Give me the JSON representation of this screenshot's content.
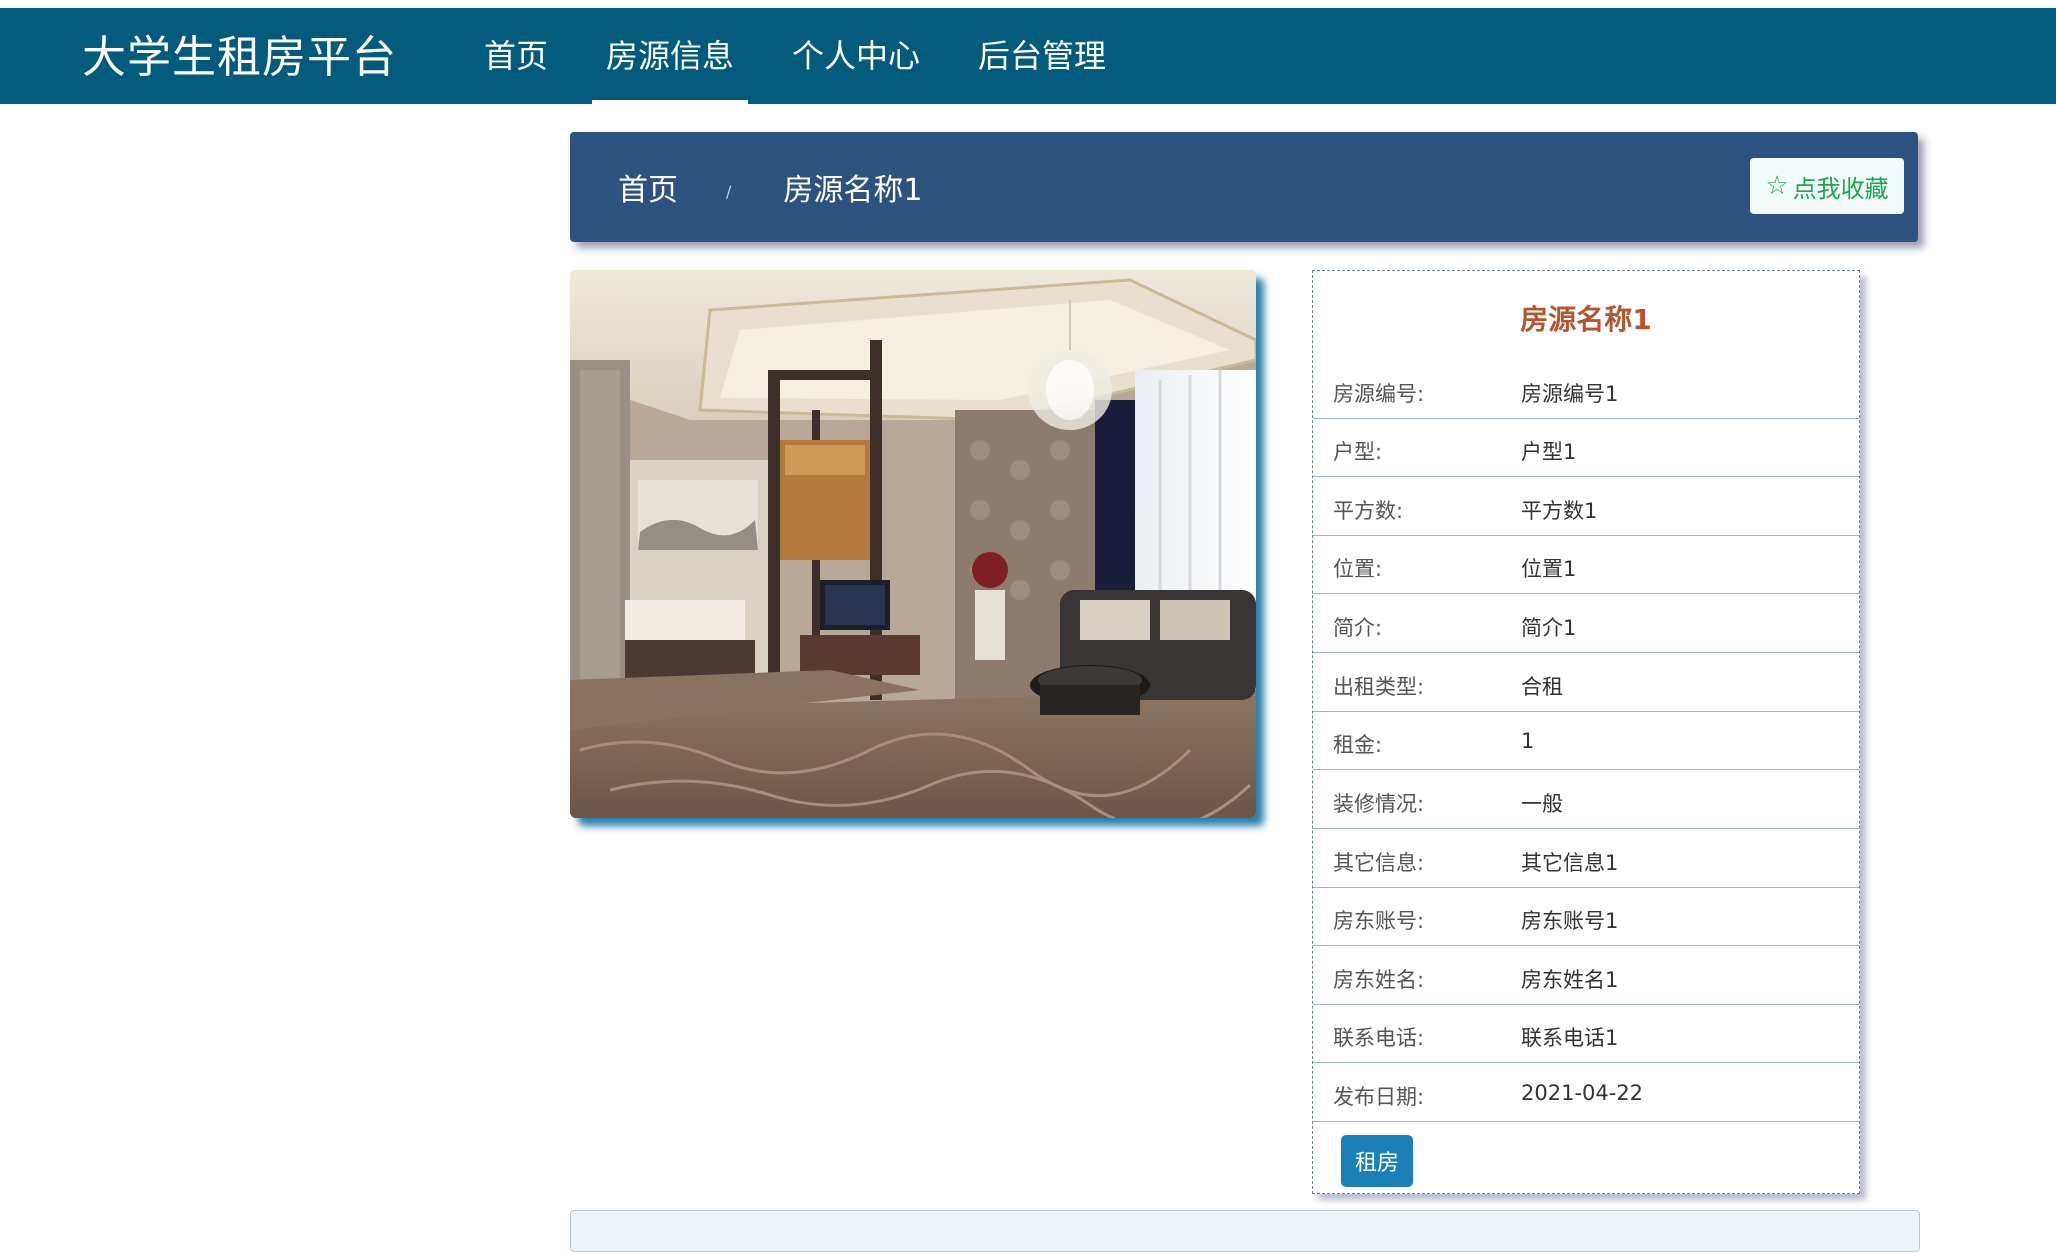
{
  "brand": "大学生租房平台",
  "nav": [
    {
      "label": "首页",
      "active": false
    },
    {
      "label": "房源信息",
      "active": true
    },
    {
      "label": "个人中心",
      "active": false
    },
    {
      "label": "后台管理",
      "active": false
    }
  ],
  "breadcrumb": {
    "home": "首页",
    "separator": "/",
    "current": "房源名称1"
  },
  "favorite_button": {
    "icon": "star-outline-icon",
    "label": "点我收藏"
  },
  "listing": {
    "title": "房源名称1",
    "fields": [
      {
        "label": "房源编号:",
        "value": "房源编号1"
      },
      {
        "label": "户型:",
        "value": "户型1"
      },
      {
        "label": "平方数:",
        "value": "平方数1"
      },
      {
        "label": "位置:",
        "value": "位置1"
      },
      {
        "label": "简介:",
        "value": "简介1"
      },
      {
        "label": "出租类型:",
        "value": "合租"
      },
      {
        "label": "租金:",
        "value": "1"
      },
      {
        "label": "装修情况:",
        "value": "一般"
      },
      {
        "label": "其它信息:",
        "value": "其它信息1"
      },
      {
        "label": "房东账号:",
        "value": "房东账号1"
      },
      {
        "label": "房东姓名:",
        "value": "房东姓名1"
      },
      {
        "label": "联系电话:",
        "value": "联系电话1"
      },
      {
        "label": "发布日期:",
        "value": "2021-04-22"
      }
    ],
    "rent_button": "租房"
  },
  "colors": {
    "topbar": "#025a7c",
    "breadcrumb_bar": "#2e527f",
    "title": "#b5552f",
    "favorite_text": "#1aa84f",
    "rent_button": "#1b7fb8"
  }
}
